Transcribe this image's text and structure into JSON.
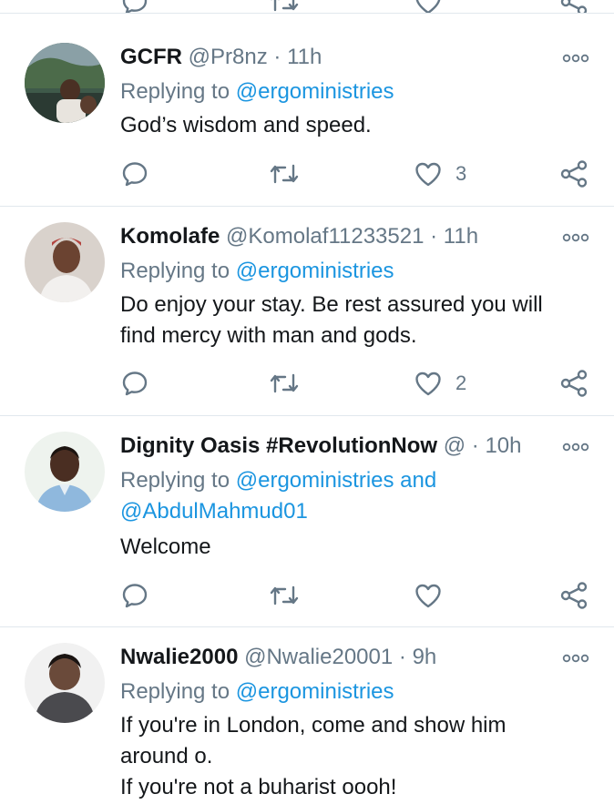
{
  "colors": {
    "name": "#14171a",
    "meta": "#657786",
    "link": "#1b95e0",
    "divider": "#e1e8ed"
  },
  "icons": [
    "reply-icon",
    "retweet-icon",
    "like-icon",
    "share-icon",
    "more-icon"
  ],
  "reply_prefix": "Replying to",
  "tweets": [
    {
      "name": "GCFR",
      "handle": "@Pr8nz",
      "sep": "·",
      "time": "11h",
      "reply_to": "@ergoministries",
      "reply_to_2": "",
      "reply_joiner": "",
      "text_lines": [
        "God’s wisdom and speed."
      ],
      "likes": "3"
    },
    {
      "name": "Komolafe",
      "handle": "@Komolaf11233521",
      "sep": "·",
      "time": "11h",
      "reply_to": "@ergoministries",
      "reply_to_2": "",
      "reply_joiner": "",
      "text_lines": [
        "Do enjoy your stay. Be rest assured you will",
        "find mercy with man and gods."
      ],
      "likes": "2"
    },
    {
      "name": "Dignity Oasis #RevolutionNow",
      "handle": "@",
      "sep": "·",
      "time": "10h",
      "reply_to": "@ergoministries",
      "reply_joiner": "and",
      "reply_to_2": "@AbdulMahmud01",
      "text_lines": [
        "Welcome"
      ],
      "likes": ""
    },
    {
      "name": "Nwalie2000",
      "handle": "@Nwalie20001",
      "sep": "·",
      "time": "9h",
      "reply_to": "@ergoministries",
      "reply_to_2": "",
      "reply_joiner": "",
      "text_lines": [
        "If you're in London, come and show him",
        "around o.",
        "If you're not a buharist oooh!"
      ],
      "likes": ""
    }
  ]
}
